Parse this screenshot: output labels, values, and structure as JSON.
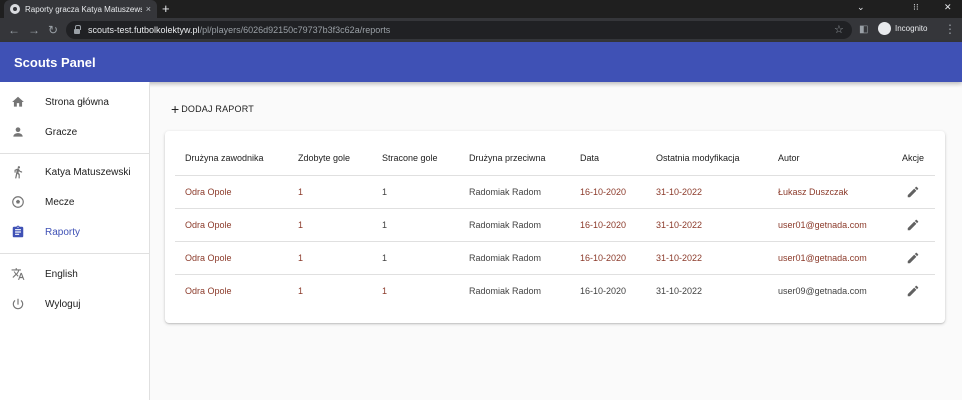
{
  "browser": {
    "tab_title": "Raporty gracza Katya Matuszewski",
    "tab_close": "×",
    "new_tab": "+",
    "url_host": "scouts-test.futbolkolektyw.pl",
    "url_path": "/pl/players/6026d92150c79737b3f3c62a/reports",
    "profile_label": "Incognito"
  },
  "app": {
    "title": "Scouts Panel"
  },
  "sidebar": {
    "items": [
      {
        "label": "Strona główna",
        "icon": "home-icon"
      },
      {
        "label": "Gracze",
        "icon": "person-icon"
      },
      {
        "label": "Katya Matuszewski",
        "icon": "running-icon"
      },
      {
        "label": "Mecze",
        "icon": "soccer-ball-icon"
      },
      {
        "label": "Raporty",
        "icon": "clipboard-icon"
      },
      {
        "label": "English",
        "icon": "translate-icon"
      },
      {
        "label": "Wyloguj",
        "icon": "power-icon"
      }
    ],
    "active_color": "#3f51b5"
  },
  "toolbar": {
    "add_label": "DODAJ RAPORT"
  },
  "table": {
    "headers": [
      "Drużyna zawodnika",
      "Zdobyte gole",
      "Stracone gole",
      "Drużyna przeciwna",
      "Data",
      "Ostatnia modyfikacja",
      "Autor",
      "Akcje"
    ],
    "rows": [
      [
        "Odra Opole",
        "1",
        "1",
        "Radomiak Radom",
        "16-10-2020",
        "31-10-2022",
        "Łukasz Duszczak"
      ],
      [
        "Odra Opole",
        "1",
        "1",
        "Radomiak Radom",
        "16-10-2020",
        "31-10-2022",
        "user01@getnada.com"
      ],
      [
        "Odra Opole",
        "1",
        "1",
        "Radomiak Radom",
        "16-10-2020",
        "31-10-2022",
        "user01@getnada.com"
      ],
      [
        "Odra Opole",
        "1",
        "1",
        "Radomiak Radom",
        "16-10-2020",
        "31-10-2022",
        "user09@getnada.com"
      ]
    ]
  }
}
